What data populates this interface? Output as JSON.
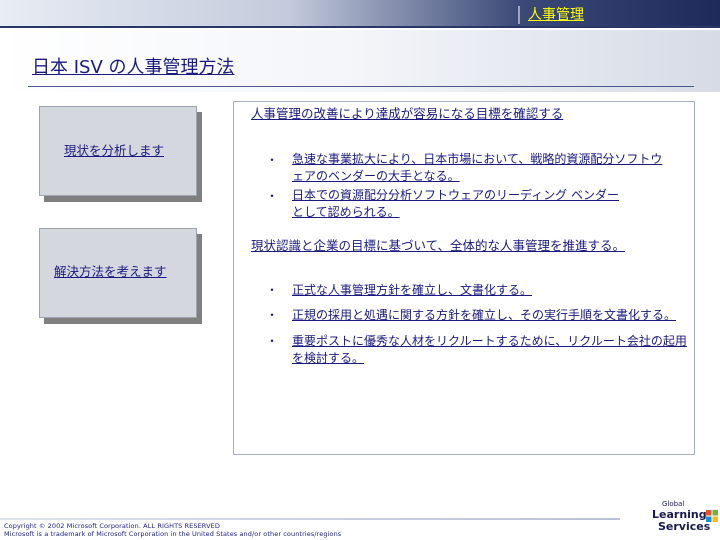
{
  "header": {
    "section_label": "人事管理"
  },
  "page": {
    "title": "日本 ISV の人事管理方法"
  },
  "left_boxes": [
    {
      "label": "現状を分析します"
    },
    {
      "label": "解決方法を考えます"
    }
  ],
  "content": {
    "heading_1": "人事管理の改善により達成が容易になる目標を確認する",
    "group_1": [
      {
        "line1": "急速な事業拡大により、日本市場において、戦略的資源配分ソフトウ",
        "line2": "ェアのベンダーの大手となる。"
      },
      {
        "line1": "日本での資源配分分析ソフトウェアのリーディング  ベンダー",
        "line2": "として認められる。"
      }
    ],
    "heading_2": "現状認識と企業の目標に基づいて、全体的な人事管理を推進する。",
    "group_2": [
      {
        "line1": "正式な人事管理方針を確立し、文書化する。",
        "line2": ""
      },
      {
        "line1": "正規の採用と処遇に関する方針を確立し、その実行手順を文書化する。",
        "line2": ""
      },
      {
        "line1": "重要ポストに優秀な人材をリクルートするために、リクルート会社の起用",
        "line2": "を検討する。"
      }
    ],
    "bullet_char": "・"
  },
  "footer": {
    "copyright": "Copyright © 2002 Microsoft Corporation. ALL RIGHTS RESERVED",
    "trademark": "Microsoft is a trademark of Microsoft Corporation in the United States and/or other countries/regions"
  },
  "logo": {
    "global": "Global",
    "learning": "Learning",
    "services": "Services"
  },
  "colors": {
    "text": "#1a1a80",
    "accent": "#ffff00",
    "header_dark": "#1d2a5a",
    "box_fill": "#d4d7de"
  }
}
